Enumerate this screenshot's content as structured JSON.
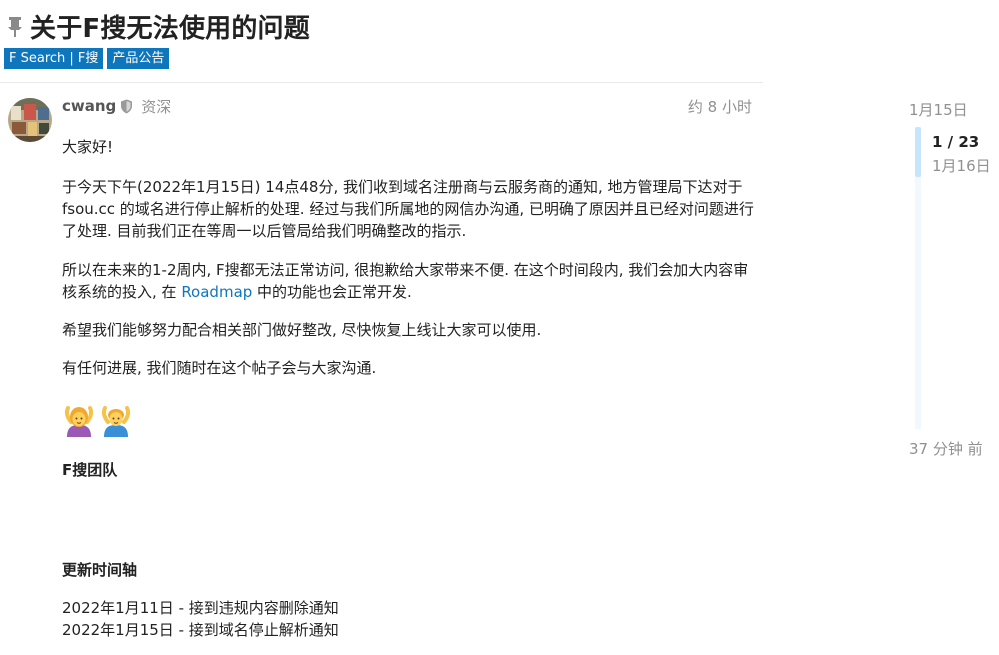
{
  "topic": {
    "title": "关于F搜无法使用的问题",
    "tags": [
      "F Search | F搜",
      "产品公告"
    ]
  },
  "post": {
    "username": "cwang",
    "user_title": "资深",
    "time": "约 8 小时",
    "greeting": "大家好!",
    "paragraph1": "于今天下午(2022年1月15日) 14点48分, 我们收到域名注册商与云服务商的通知, 地方管理局下达对于 fsou.cc 的域名进行停止解析的处理. 经过与我们所属地的网信办沟通, 已明确了原因并且已经对问题进行了处理. 目前我们正在等周一以后管局给我们明确整改的指示.",
    "paragraph2_before": "所以在未来的1-2周内, F搜都无法正常访问, 很抱歉给大家带来不便. 在这个时间段内, 我们会加大内容审核系统的投入, 在 ",
    "paragraph2_link": "Roadmap",
    "paragraph2_after": " 中的功能也会正常开发.",
    "paragraph3": "希望我们能够努力配合相关部门做好整改, 尽快恢复上线让大家可以使用.",
    "paragraph4": "有任何进展, 我们随时在这个帖子会与大家沟通.",
    "emojis": [
      "woman-gesturing-ok",
      "man-gesturing-ok"
    ],
    "signature": "F搜团队",
    "timeline_heading": "更新时间轴",
    "timeline_items": [
      "2022年1月11日 - 接到违规内容删除通知",
      "2022年1月15日 - 接到域名停止解析通知"
    ]
  },
  "timeline": {
    "start_date": "1月15日",
    "progress": "1 / 23",
    "current_date": "1月16日",
    "end_label": "37 分钟 前"
  },
  "colors": {
    "tag_bg": "#0e76bd",
    "link": "#0e76bd",
    "muted": "#919191",
    "timeline_handle": "#c8e6fb",
    "timeline_track": "#f1f9ff"
  }
}
